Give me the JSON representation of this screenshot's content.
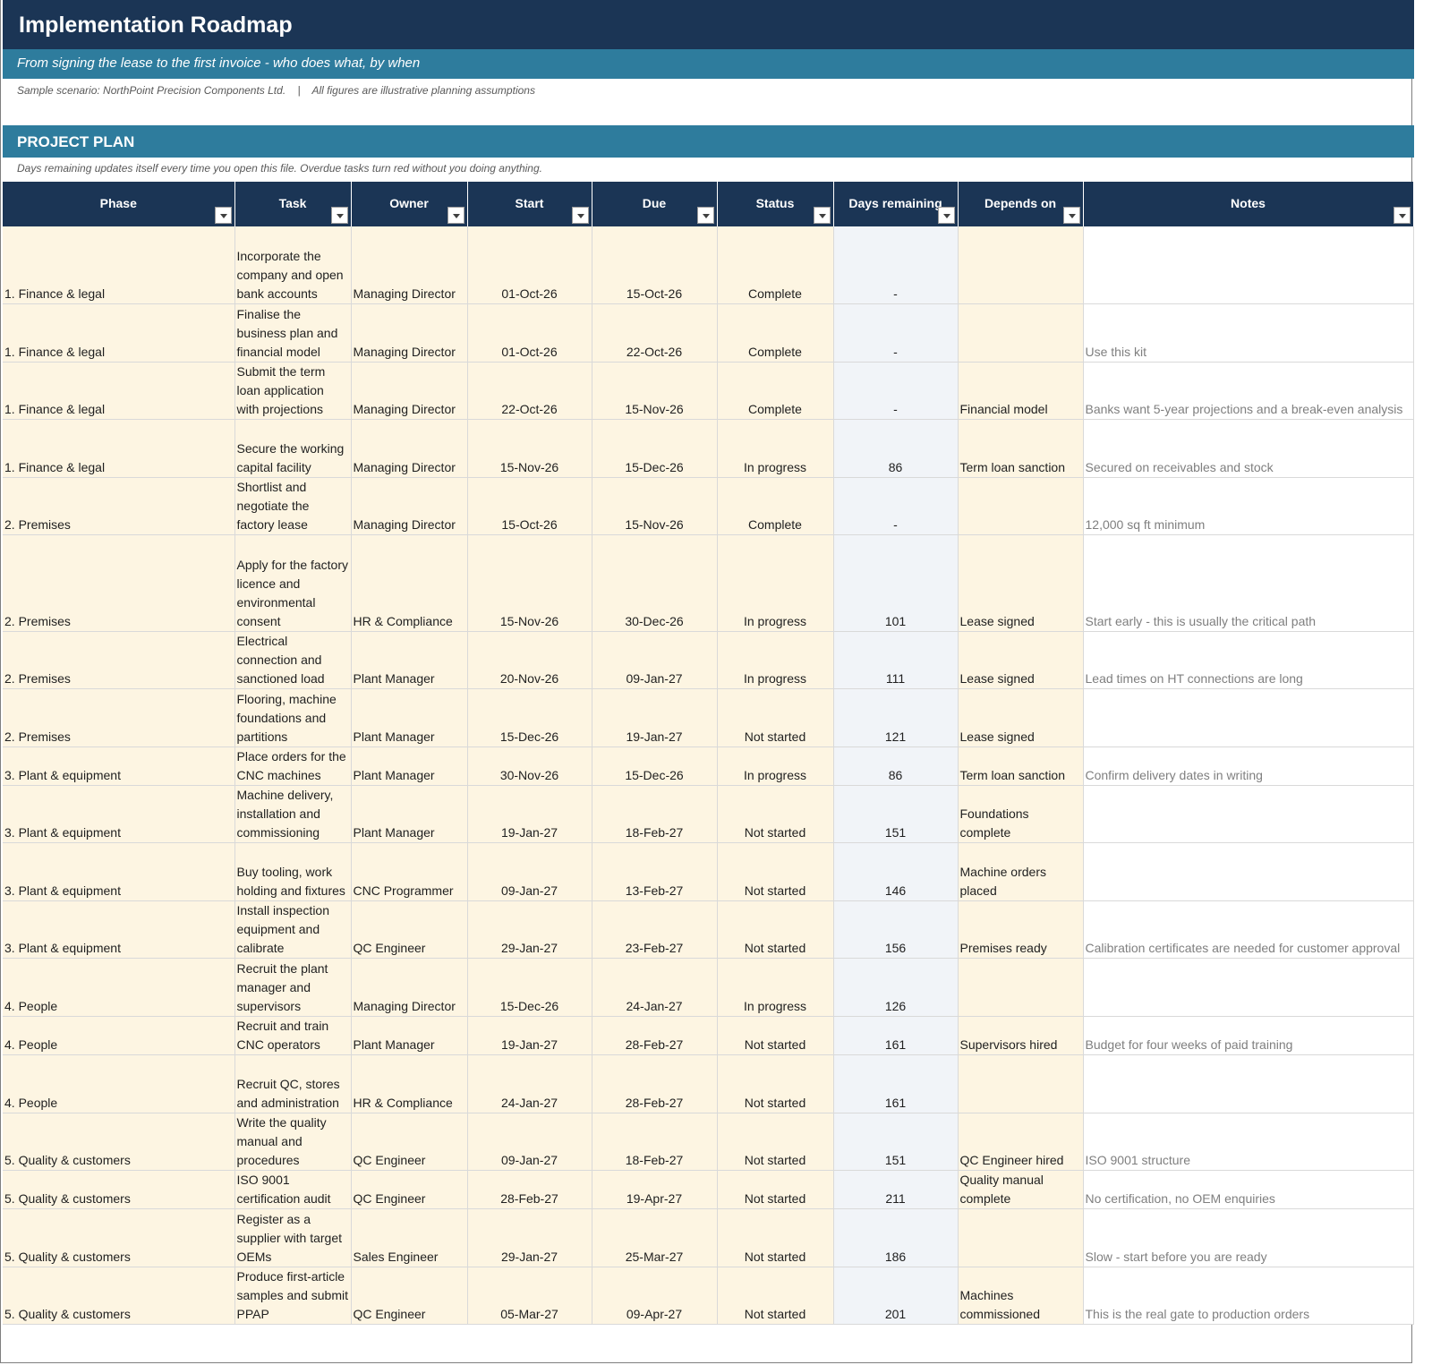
{
  "header": {
    "title": "Implementation Roadmap",
    "subtitle": "From signing the lease to the first invoice - who does what, by when",
    "scenario": "Sample scenario: NorthPoint Precision Components Ltd.    |    All figures are illustrative planning assumptions"
  },
  "section": {
    "title": "PROJECT PLAN",
    "hint": "Days remaining updates itself every time you open this file. Overdue tasks turn red without you doing anything."
  },
  "columns": [
    "Phase",
    "Task",
    "Owner",
    "Start",
    "Due",
    "Status",
    "Days remaining",
    "Depends on",
    "Notes"
  ],
  "rows": [
    {
      "phase": "1. Finance & legal",
      "task": "Incorporate the company and open bank accounts",
      "owner": "Managing Director",
      "start": "01-Oct-26",
      "due": "15-Oct-26",
      "status": "Complete",
      "days": "-",
      "depends": "",
      "notes": ""
    },
    {
      "phase": "1. Finance & legal",
      "task": "Finalise the business plan and financial model",
      "owner": "Managing Director",
      "start": "01-Oct-26",
      "due": "22-Oct-26",
      "status": "Complete",
      "days": "-",
      "depends": "",
      "notes": "Use this kit"
    },
    {
      "phase": "1. Finance & legal",
      "task": "Submit the term loan application with projections",
      "owner": "Managing Director",
      "start": "22-Oct-26",
      "due": "15-Nov-26",
      "status": "Complete",
      "days": "-",
      "depends": "Financial model",
      "notes": "Banks want 5-year projections and a break-even analysis"
    },
    {
      "phase": "1. Finance & legal",
      "task": "Secure the working capital facility",
      "owner": "Managing Director",
      "start": "15-Nov-26",
      "due": "15-Dec-26",
      "status": "In progress",
      "days": "86",
      "depends": "Term loan sanction",
      "notes": "Secured on receivables and stock"
    },
    {
      "phase": "2. Premises",
      "task": "Shortlist and negotiate the factory lease",
      "owner": "Managing Director",
      "start": "15-Oct-26",
      "due": "15-Nov-26",
      "status": "Complete",
      "days": "-",
      "depends": "",
      "notes": "12,000 sq ft minimum"
    },
    {
      "phase": "2. Premises",
      "task": "Apply for the factory licence and environmental consent",
      "owner": "HR & Compliance",
      "start": "15-Nov-26",
      "due": "30-Dec-26",
      "status": "In progress",
      "days": "101",
      "depends": "Lease signed",
      "notes": "Start early - this is usually the critical path"
    },
    {
      "phase": "2. Premises",
      "task": "Electrical connection and sanctioned load",
      "owner": "Plant Manager",
      "start": "20-Nov-26",
      "due": "09-Jan-27",
      "status": "In progress",
      "days": "111",
      "depends": "Lease signed",
      "notes": "Lead times on HT connections are long"
    },
    {
      "phase": "2. Premises",
      "task": "Flooring, machine foundations and partitions",
      "owner": "Plant Manager",
      "start": "15-Dec-26",
      "due": "19-Jan-27",
      "status": "Not started",
      "days": "121",
      "depends": "Lease signed",
      "notes": ""
    },
    {
      "phase": "3. Plant & equipment",
      "task": "Place orders for the CNC machines",
      "owner": "Plant Manager",
      "start": "30-Nov-26",
      "due": "15-Dec-26",
      "status": "In progress",
      "days": "86",
      "depends": "Term loan sanction",
      "notes": "Confirm delivery dates in writing"
    },
    {
      "phase": "3. Plant & equipment",
      "task": "Machine delivery, installation and commissioning",
      "owner": "Plant Manager",
      "start": "19-Jan-27",
      "due": "18-Feb-27",
      "status": "Not started",
      "days": "151",
      "depends": "Foundations complete",
      "notes": ""
    },
    {
      "phase": "3. Plant & equipment",
      "task": "Buy tooling, work holding and fixtures",
      "owner": "CNC Programmer",
      "start": "09-Jan-27",
      "due": "13-Feb-27",
      "status": "Not started",
      "days": "146",
      "depends": "Machine orders placed",
      "notes": ""
    },
    {
      "phase": "3. Plant & equipment",
      "task": "Install inspection equipment and calibrate",
      "owner": "QC Engineer",
      "start": "29-Jan-27",
      "due": "23-Feb-27",
      "status": "Not started",
      "days": "156",
      "depends": "Premises ready",
      "notes": "Calibration certificates are needed for customer approval"
    },
    {
      "phase": "4. People",
      "task": "Recruit the plant manager and supervisors",
      "owner": "Managing Director",
      "start": "15-Dec-26",
      "due": "24-Jan-27",
      "status": "In progress",
      "days": "126",
      "depends": "",
      "notes": ""
    },
    {
      "phase": "4. People",
      "task": "Recruit and train CNC operators",
      "owner": "Plant Manager",
      "start": "19-Jan-27",
      "due": "28-Feb-27",
      "status": "Not started",
      "days": "161",
      "depends": "Supervisors hired",
      "notes": "Budget for four weeks of paid training"
    },
    {
      "phase": "4. People",
      "task": "Recruit QC, stores and administration",
      "owner": "HR & Compliance",
      "start": "24-Jan-27",
      "due": "28-Feb-27",
      "status": "Not started",
      "days": "161",
      "depends": "",
      "notes": ""
    },
    {
      "phase": "5. Quality & customers",
      "task": "Write the quality manual and procedures",
      "owner": "QC Engineer",
      "start": "09-Jan-27",
      "due": "18-Feb-27",
      "status": "Not started",
      "days": "151",
      "depends": "QC Engineer hired",
      "notes": "ISO 9001 structure"
    },
    {
      "phase": "5. Quality & customers",
      "task": "ISO 9001 certification audit",
      "owner": "QC Engineer",
      "start": "28-Feb-27",
      "due": "19-Apr-27",
      "status": "Not started",
      "days": "211",
      "depends": "Quality manual complete",
      "notes": "No certification, no OEM enquiries"
    },
    {
      "phase": "5. Quality & customers",
      "task": "Register as a supplier with target OEMs",
      "owner": "Sales Engineer",
      "start": "29-Jan-27",
      "due": "25-Mar-27",
      "status": "Not started",
      "days": "186",
      "depends": "",
      "notes": "Slow - start before you are ready"
    },
    {
      "phase": "5. Quality & customers",
      "task": "Produce first-article samples and submit PPAP",
      "owner": "QC Engineer",
      "start": "05-Mar-27",
      "due": "09-Apr-27",
      "status": "Not started",
      "days": "201",
      "depends": "Machines commissioned",
      "notes": "This is the real gate to production orders"
    }
  ]
}
